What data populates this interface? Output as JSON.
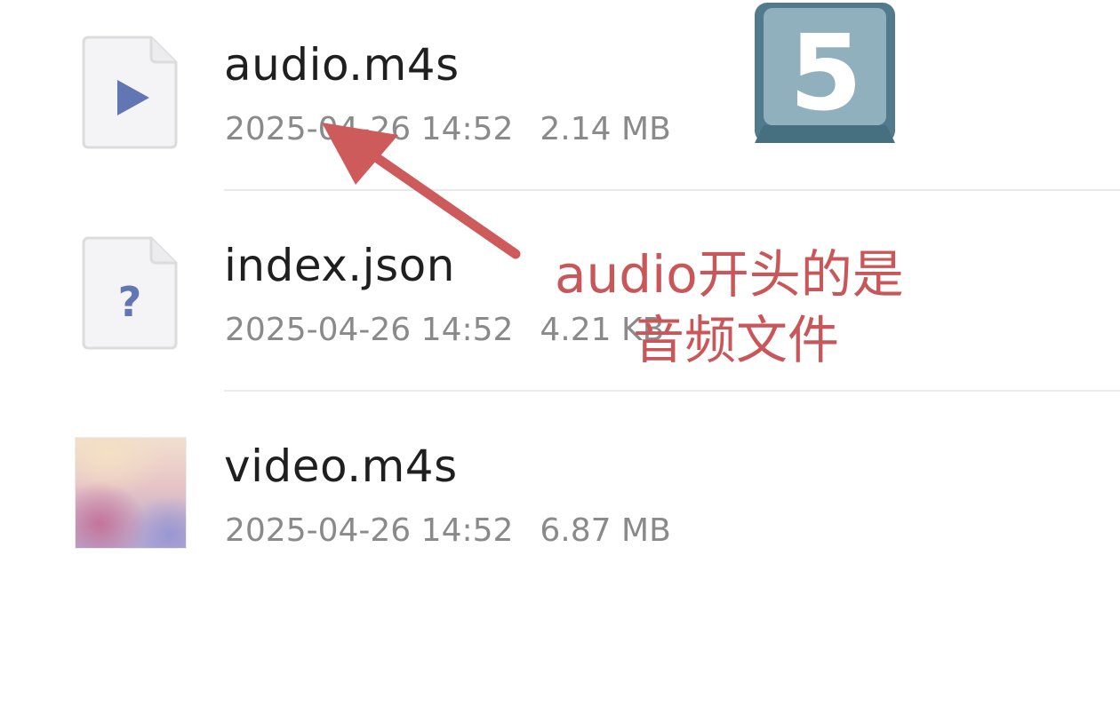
{
  "files": [
    {
      "name": "audio.m4s",
      "date": "2025-04-26 14:52",
      "size": "2.14 MB",
      "icon": "audio-file-icon"
    },
    {
      "name": "index.json",
      "date": "2025-04-26 14:52",
      "size": "4.21 KB",
      "icon": "unknown-file-icon"
    },
    {
      "name": "video.m4s",
      "date": "2025-04-26 14:52",
      "size": "6.87 MB",
      "icon": "video-thumbnail"
    }
  ],
  "step_badge": {
    "label": "5",
    "icon": "keycap-5-icon"
  },
  "annotation": {
    "line1": "audio开头的是",
    "line2": "音频文件",
    "color": "#c9575a"
  },
  "colors": {
    "icon_accent": "#6276b4",
    "arrow": "#cd5b5b"
  }
}
